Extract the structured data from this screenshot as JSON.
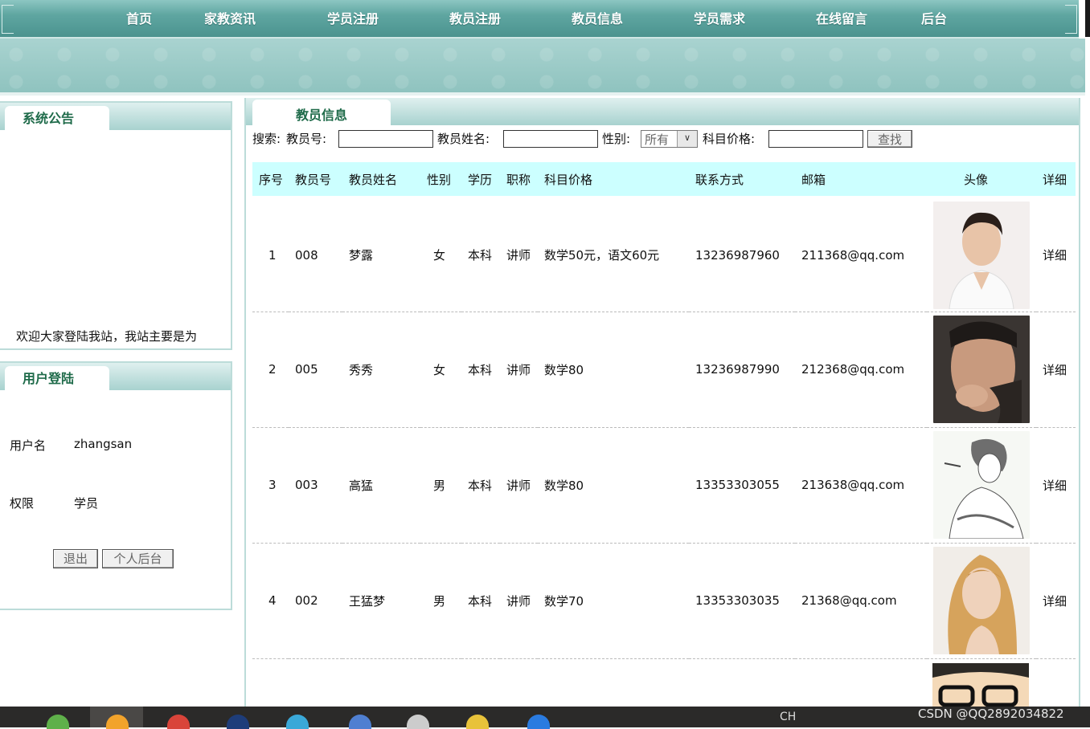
{
  "nav": {
    "items": [
      "首页",
      "家教资讯",
      "学员注册",
      "教员注册",
      "教员信息",
      "学员需求",
      "在线留言",
      "后台"
    ]
  },
  "notice_panel": {
    "title": "系统公告",
    "text": "欢迎大家登陆我站，我站主要是为"
  },
  "login_panel": {
    "title": "用户登陆",
    "username_label": "用户名",
    "username_value": "zhangsan",
    "role_label": "权限",
    "role_value": "学员",
    "logout_button": "退出",
    "personal_button": "个人后台"
  },
  "main": {
    "title": "教员信息",
    "search": {
      "prefix": "搜索:",
      "teacher_no_label": "教员号:",
      "teacher_name_label": "教员姓名:",
      "gender_label": "性别:",
      "gender_selected": "所有",
      "price_label": "科目价格:",
      "search_button": "查找"
    },
    "table": {
      "headers": [
        "序号",
        "教员号",
        "教员姓名",
        "性别",
        "学历",
        "职称",
        "科目价格",
        "联系方式",
        "邮箱",
        "头像",
        "详细"
      ],
      "rows": [
        {
          "idx": "1",
          "no": "008",
          "name": "梦露",
          "gender": "女",
          "edu": "本科",
          "title": "讲师",
          "price": "数学50元，语文60元",
          "phone": "13236987960",
          "email": "211368@qq.com",
          "detail": "详细"
        },
        {
          "idx": "2",
          "no": "005",
          "name": "秀秀",
          "gender": "女",
          "edu": "本科",
          "title": "讲师",
          "price": "数学80",
          "phone": "13236987990",
          "email": "212368@qq.com",
          "detail": "详细"
        },
        {
          "idx": "3",
          "no": "003",
          "name": "高猛",
          "gender": "男",
          "edu": "本科",
          "title": "讲师",
          "price": "数学80",
          "phone": "13353303055",
          "email": "213638@qq.com",
          "detail": "详细"
        },
        {
          "idx": "4",
          "no": "002",
          "name": "王猛梦",
          "gender": "男",
          "edu": "本科",
          "title": "讲师",
          "price": "数学70",
          "phone": "13353303035",
          "email": "21368@qq.com",
          "detail": "详细"
        }
      ]
    }
  },
  "taskbar": {
    "lang": "CH",
    "watermark": "CSDN @QQ2892034822"
  },
  "colors": {
    "nav_teal": "#5fa6a1",
    "table_header": "#ccffff",
    "panel_title": "#1f6b4a"
  }
}
